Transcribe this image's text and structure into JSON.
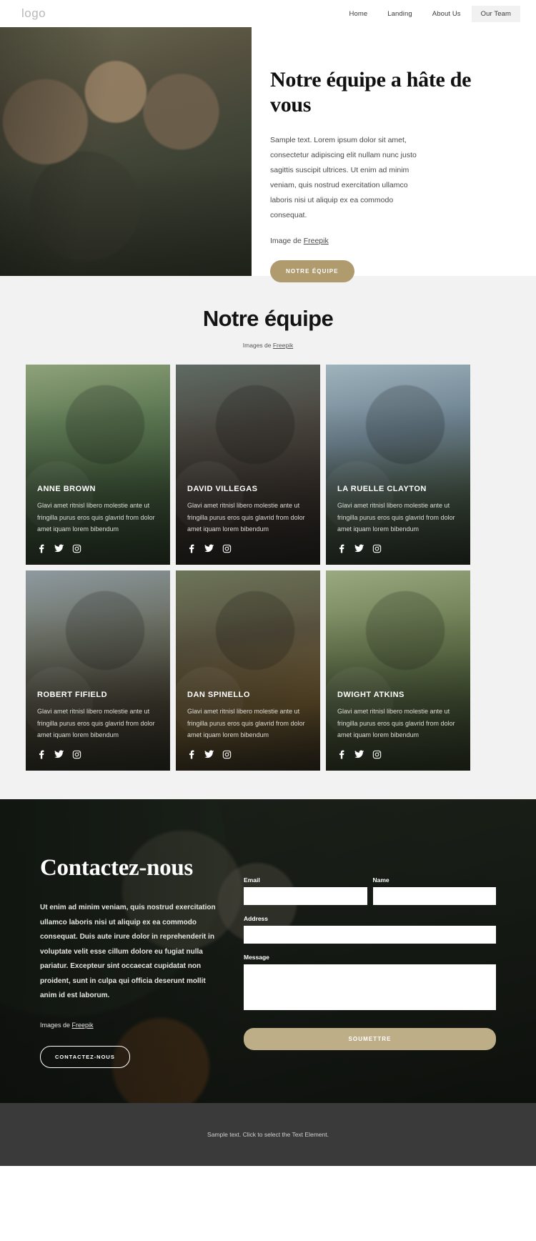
{
  "header": {
    "logo": "logo",
    "nav": [
      {
        "label": "Home",
        "active": false
      },
      {
        "label": "Landing",
        "active": false
      },
      {
        "label": "About Us",
        "active": false
      },
      {
        "label": "Our Team",
        "active": true
      }
    ]
  },
  "hero": {
    "title": "Notre équipe a hâte de vous",
    "body": "Sample text. Lorem ipsum dolor sit amet, consectetur adipiscing elit nullam nunc justo sagittis suscipit ultrices. Ut enim ad minim veniam, quis nostrud exercitation ullamco laboris nisi ut aliquip ex ea commodo consequat.",
    "credit_prefix": "Image de ",
    "credit_link": "Freepik",
    "cta_label": "NOTRE ÉQUIPE",
    "cta_color": "#b09b6f",
    "image_alt": "team-hero-photo"
  },
  "team": {
    "title": "Notre équipe",
    "credit_prefix": "Images de ",
    "credit_link": "Freepik",
    "section_bg": "#f2f2f2",
    "members": [
      {
        "name": "ANNE BROWN",
        "desc": "Glavi amet ritnisl libero molestie ante ut fringilla purus eros quis glavrid from dolor amet iquam lorem bibendum",
        "socials": [
          "facebook-icon",
          "twitter-icon",
          "instagram-icon"
        ]
      },
      {
        "name": "DAVID VILLEGAS",
        "desc": "Glavi amet ritnisl libero molestie ante ut fringilla purus eros quis glavrid from dolor amet iquam lorem bibendum",
        "socials": [
          "facebook-icon",
          "twitter-icon",
          "instagram-icon"
        ]
      },
      {
        "name": "LA RUELLE CLAYTON",
        "desc": "Glavi amet ritnisl libero molestie ante ut fringilla purus eros quis glavrid from dolor amet iquam lorem bibendum",
        "socials": [
          "facebook-icon",
          "twitter-icon",
          "instagram-icon"
        ]
      },
      {
        "name": "ROBERT FIFIELD",
        "desc": "Glavi amet ritnisl libero molestie ante ut fringilla purus eros quis glavrid from dolor amet iquam lorem bibendum",
        "socials": [
          "facebook-icon",
          "twitter-icon",
          "instagram-icon"
        ]
      },
      {
        "name": "DAN SPINELLO",
        "desc": "Glavi amet ritnisl libero molestie ante ut fringilla purus eros quis glavrid from dolor amet iquam lorem bibendum",
        "socials": [
          "facebook-icon",
          "twitter-icon",
          "instagram-icon"
        ]
      },
      {
        "name": "DWIGHT ATKINS",
        "desc": "Glavi amet ritnisl libero molestie ante ut fringilla purus eros quis glavrid from dolor amet iquam lorem bibendum",
        "socials": [
          "facebook-icon",
          "twitter-icon",
          "instagram-icon"
        ]
      }
    ]
  },
  "contact": {
    "title": "Contactez-nous",
    "body": "Ut enim ad minim veniam, quis nostrud exercitation ullamco laboris nisi ut aliquip ex ea commodo consequat. Duis aute irure dolor in reprehenderit in voluptate velit esse cillum dolore eu fugiat nulla pariatur. Excepteur sint occaecat cupidatat non proident, sunt in culpa qui officia deserunt mollit anim id est laborum.",
    "credit_prefix": "Images de ",
    "credit_link": "Freepik",
    "cta_label": "CONTACTEZ-NOUS",
    "form": {
      "email_label": "Email",
      "email_value": "",
      "email_placeholder": "",
      "name_label": "Name",
      "name_value": "",
      "name_placeholder": "",
      "address_label": "Address",
      "address_value": "",
      "address_placeholder": "",
      "message_label": "Message",
      "message_value": "",
      "message_placeholder": "",
      "submit_label": "SOUMETTRE",
      "submit_color": "#bdae88"
    }
  },
  "footer": {
    "text": "Sample text. Click to select the Text Element.",
    "bg": "#3a3a3a"
  }
}
